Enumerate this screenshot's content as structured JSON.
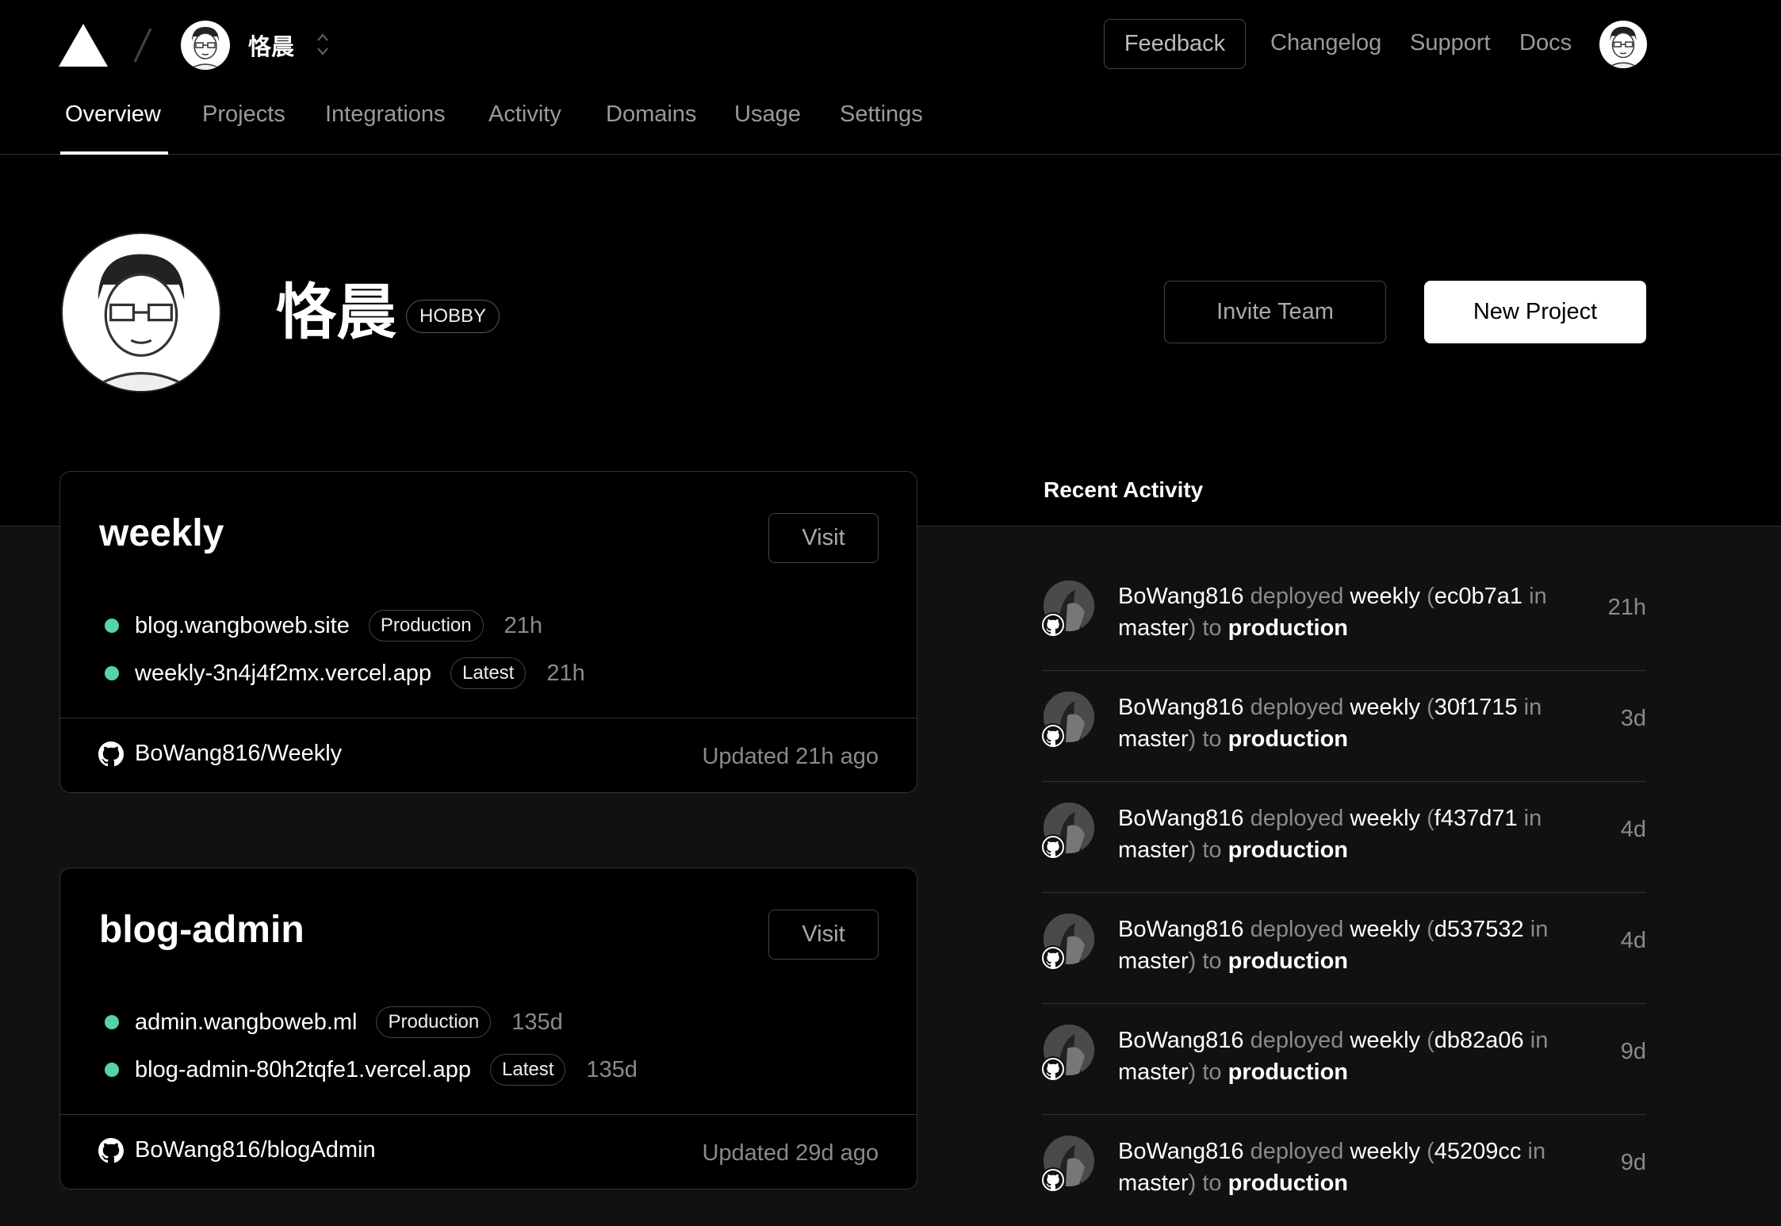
{
  "header": {
    "team_name": "恪晨",
    "feedback_label": "Feedback",
    "nav": [
      "Changelog",
      "Support",
      "Docs"
    ]
  },
  "tabs": [
    "Overview",
    "Projects",
    "Integrations",
    "Activity",
    "Domains",
    "Usage",
    "Settings"
  ],
  "active_tab": "Overview",
  "profile": {
    "name": "恪晨",
    "plan": "HOBBY",
    "invite_label": "Invite Team",
    "new_project_label": "New Project"
  },
  "projects": [
    {
      "name": "weekly",
      "visit_label": "Visit",
      "deployments": [
        {
          "url": "blog.wangboweb.site",
          "tag": "Production",
          "age": "21h"
        },
        {
          "url": "weekly-3n4j4f2mx.vercel.app",
          "tag": "Latest",
          "age": "21h"
        }
      ],
      "repo": "BoWang816/Weekly",
      "updated": "Updated 21h ago"
    },
    {
      "name": "blog-admin",
      "visit_label": "Visit",
      "deployments": [
        {
          "url": "admin.wangboweb.ml",
          "tag": "Production",
          "age": "135d"
        },
        {
          "url": "blog-admin-80h2tqfe1.vercel.app",
          "tag": "Latest",
          "age": "135d"
        }
      ],
      "repo": "BoWang816/blogAdmin",
      "updated": "Updated 29d ago"
    }
  ],
  "activity": {
    "title": "Recent Activity",
    "items": [
      {
        "user": "BoWang816",
        "verb": "deployed",
        "project": "weekly",
        "commit": "ec0b7a1",
        "branch": "master",
        "target": "production",
        "age": "21h"
      },
      {
        "user": "BoWang816",
        "verb": "deployed",
        "project": "weekly",
        "commit": "30f1715",
        "branch": "master",
        "target": "production",
        "age": "3d"
      },
      {
        "user": "BoWang816",
        "verb": "deployed",
        "project": "weekly",
        "commit": "f437d71",
        "branch": "master",
        "target": "production",
        "age": "4d"
      },
      {
        "user": "BoWang816",
        "verb": "deployed",
        "project": "weekly",
        "commit": "d537532",
        "branch": "master",
        "target": "production",
        "age": "4d"
      },
      {
        "user": "BoWang816",
        "verb": "deployed",
        "project": "weekly",
        "commit": "db82a06",
        "branch": "master",
        "target": "production",
        "age": "9d"
      },
      {
        "user": "BoWang816",
        "verb": "deployed",
        "project": "weekly",
        "commit": "45209cc",
        "branch": "master",
        "target": "production",
        "age": "9d"
      }
    ]
  },
  "colors": {
    "accent_dot": "#56d3a7",
    "background": "#111111",
    "hero": "#000000"
  }
}
